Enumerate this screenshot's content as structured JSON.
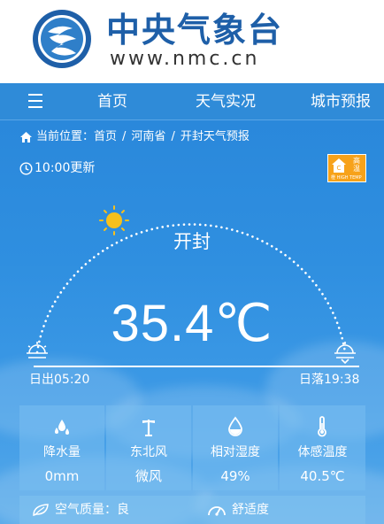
{
  "brand": {
    "title": "中央气象台",
    "url": "www.nmc.cn",
    "colors": {
      "primary": "#1e5fa8",
      "nav": "#2f8bd8"
    }
  },
  "nav": {
    "menu_icon": "menu-icon",
    "items": [
      {
        "label": "首页"
      },
      {
        "label": "天气实况"
      },
      {
        "label": "城市预报"
      }
    ]
  },
  "breadcrumb": {
    "prefix": "当前位置：",
    "items": [
      "首页",
      "河南省",
      "开封天气预报"
    ],
    "separator": "/"
  },
  "update": {
    "text": "10:00更新"
  },
  "alert": {
    "title": "高温",
    "level_color": "#f7a21a",
    "subtext": "橙 HIGH TEMP",
    "icon": "high-temperature-warning-icon"
  },
  "weather": {
    "city": "开封",
    "temperature": "35.4℃",
    "sunrise": "日出05:20",
    "sunset": "日落19:38"
  },
  "stats": [
    {
      "icon": "raindrop-icon",
      "label": "降水量",
      "value": "0mm"
    },
    {
      "icon": "wind-vane-icon",
      "label": "东北风",
      "value": "微风"
    },
    {
      "icon": "humidity-drop-icon",
      "label": "相对湿度",
      "value": "49%"
    },
    {
      "icon": "thermometer-icon",
      "label": "体感温度",
      "value": "40.5℃"
    }
  ],
  "bottom": {
    "air_quality": "空气质量：良",
    "comfort": "舒适度"
  }
}
